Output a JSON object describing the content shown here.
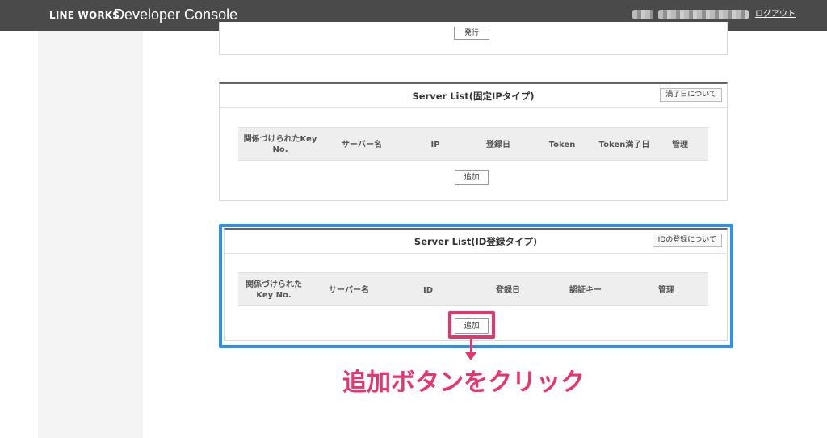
{
  "header": {
    "brand": "LINE WORKS",
    "console_title": "Developer Console",
    "logout_label": "ログアウト"
  },
  "top_panel": {
    "issue_button": "発行"
  },
  "server_list_fixed_ip": {
    "title": "Server List(固定IPタイプ)",
    "note_button": "満了日について",
    "columns": [
      "関係づけられたKey No.",
      "サーバー名",
      "IP",
      "登録日",
      "Token",
      "Token満了日",
      "管理"
    ],
    "add_button": "追加"
  },
  "server_list_id": {
    "title": "Server List(ID登録タイプ)",
    "note_button": "IDの登録について",
    "columns": [
      "関係づけられたKey No.",
      "サーバー名",
      "ID",
      "登録日",
      "認証キー",
      "管理"
    ],
    "add_button": "追加"
  },
  "annotation": {
    "callout_text": "追加ボタンをクリック",
    "highlight_color": "#2d8fef",
    "accent_color": "#e8336d"
  }
}
